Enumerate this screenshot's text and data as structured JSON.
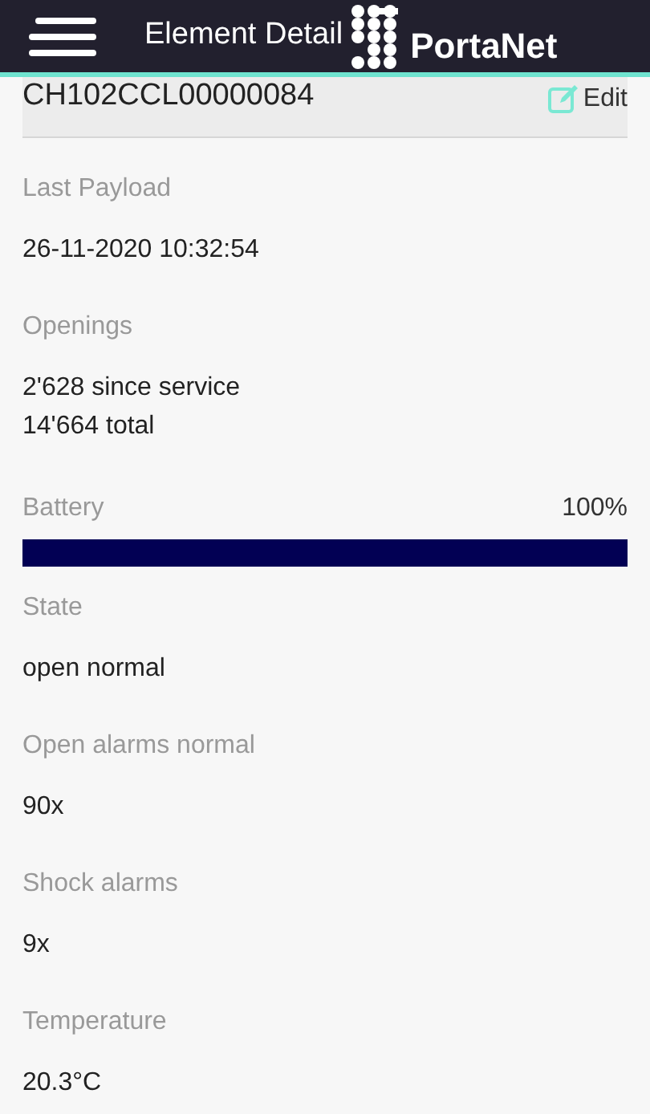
{
  "header": {
    "title": "Element Detail",
    "brand": "PortaNet"
  },
  "element": {
    "id": "CH102CCL00000084",
    "edit_label": "Edit"
  },
  "fields": [
    {
      "kind": "text",
      "label": "Last Payload",
      "lines": [
        "26-11-2020 10:32:54"
      ]
    },
    {
      "kind": "text",
      "label": "Openings",
      "lines": [
        "2'628 since service",
        "14'664 total"
      ]
    },
    {
      "kind": "meter",
      "label": "Battery",
      "reading": "100%",
      "level": 1
    },
    {
      "kind": "text",
      "label": "State",
      "lines": [
        "open normal"
      ]
    },
    {
      "kind": "text",
      "label": "Open alarms normal",
      "lines": [
        "90x"
      ]
    },
    {
      "kind": "text",
      "label": "Shock alarms",
      "lines": [
        "9x"
      ]
    },
    {
      "kind": "text",
      "label": "Temperature",
      "lines": [
        "20.3°C"
      ]
    }
  ]
}
